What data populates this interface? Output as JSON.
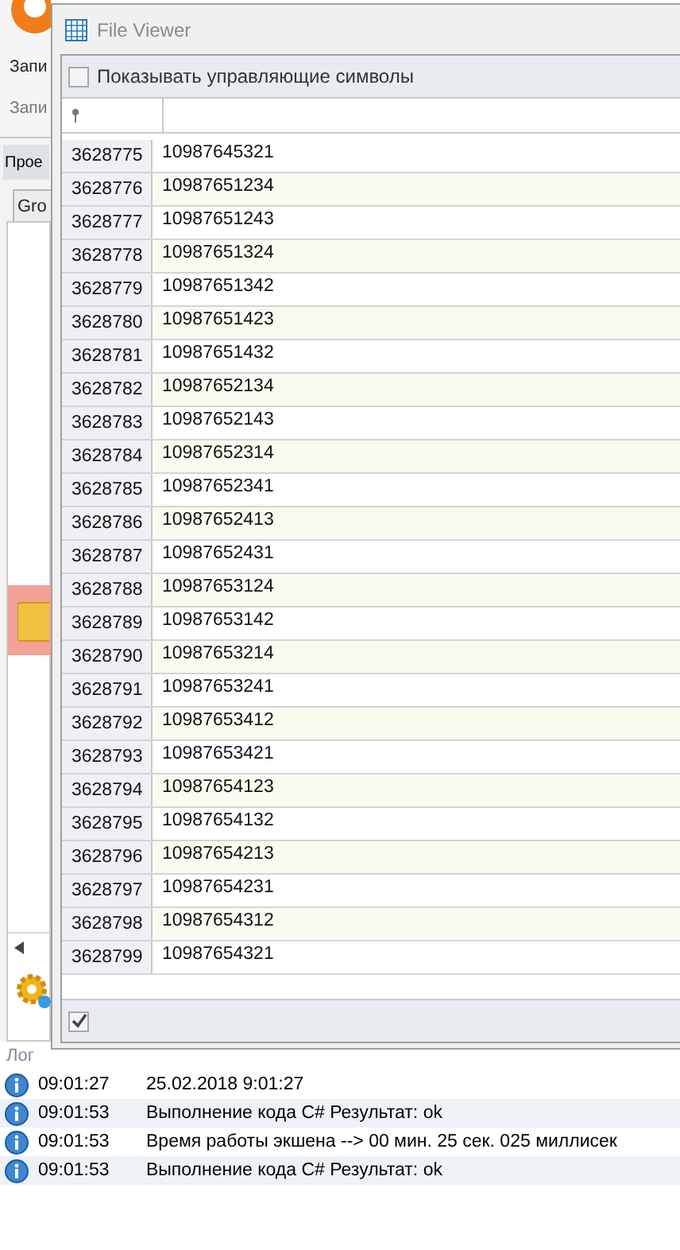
{
  "background_app": {
    "ribbon_button": "Запи",
    "ribbon_group": "Запи",
    "panel_tab": "Прое",
    "sub_tab": "Gro"
  },
  "window": {
    "title": "File Viewer"
  },
  "options": {
    "label": "Показывать управляющие символы",
    "checked": false
  },
  "rows": [
    {
      "id": "3628775",
      "value": "10987645321"
    },
    {
      "id": "3628776",
      "value": "10987651234"
    },
    {
      "id": "3628777",
      "value": "10987651243"
    },
    {
      "id": "3628778",
      "value": "10987651324"
    },
    {
      "id": "3628779",
      "value": "10987651342"
    },
    {
      "id": "3628780",
      "value": "10987651423"
    },
    {
      "id": "3628781",
      "value": "10987651432"
    },
    {
      "id": "3628782",
      "value": "10987652134"
    },
    {
      "id": "3628783",
      "value": "10987652143"
    },
    {
      "id": "3628784",
      "value": "10987652314"
    },
    {
      "id": "3628785",
      "value": "10987652341"
    },
    {
      "id": "3628786",
      "value": "10987652413"
    },
    {
      "id": "3628787",
      "value": "10987652431"
    },
    {
      "id": "3628788",
      "value": "10987653124"
    },
    {
      "id": "3628789",
      "value": "10987653142"
    },
    {
      "id": "3628790",
      "value": "10987653214"
    },
    {
      "id": "3628791",
      "value": "10987653241"
    },
    {
      "id": "3628792",
      "value": "10987653412"
    },
    {
      "id": "3628793",
      "value": "10987653421"
    },
    {
      "id": "3628794",
      "value": "10987654123"
    },
    {
      "id": "3628795",
      "value": "10987654132"
    },
    {
      "id": "3628796",
      "value": "10987654213"
    },
    {
      "id": "3628797",
      "value": "10987654231"
    },
    {
      "id": "3628798",
      "value": "10987654312"
    },
    {
      "id": "3628799",
      "value": "10987654321"
    }
  ],
  "footer": {
    "checked": true
  },
  "log": {
    "title": "Лог",
    "entries": [
      {
        "time": "09:01:27",
        "message": "25.02.2018 9:01:27"
      },
      {
        "time": "09:01:53",
        "message": "Выполнение кода C#  Результат: ok"
      },
      {
        "time": "09:01:53",
        "message": "Время работы экшена --> 00 мин. 25 сек. 025 миллисек"
      },
      {
        "time": "09:01:53",
        "message": "Выполнение кода C#  Результат: ok"
      }
    ]
  }
}
